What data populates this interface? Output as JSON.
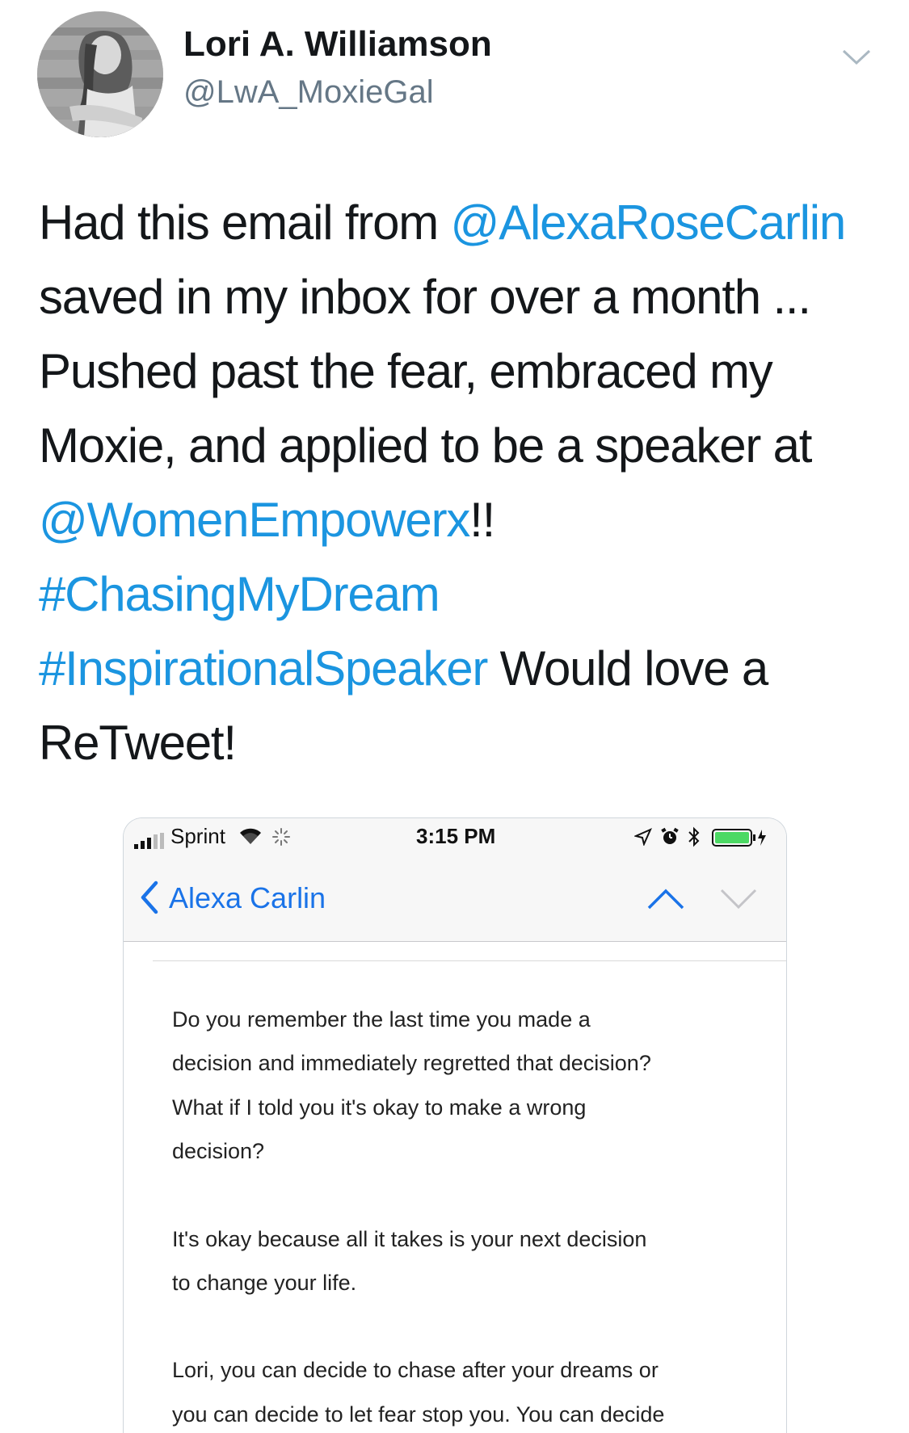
{
  "tweet": {
    "author_name": "Lori A. Williamson",
    "author_handle": "@LwA_MoxieGal",
    "lines": [
      [
        {
          "t": "Had this email from ",
          "link": false
        },
        {
          "t": "@AlexaRoseCarlin",
          "link": true
        }
      ],
      [
        {
          "t": "saved in my inbox for over a month ...",
          "link": false
        }
      ],
      [
        {
          "t": "Pushed past the fear, embraced my",
          "link": false
        }
      ],
      [
        {
          "t": "Moxie, and applied to be a speaker at",
          "link": false
        }
      ],
      [
        {
          "t": "@WomenEmpowerx",
          "link": true
        },
        {
          "t": "!!",
          "link": false
        }
      ],
      [
        {
          "t": "#ChasingMyDream",
          "link": true
        }
      ],
      [
        {
          "t": "#InspirationalSpeaker",
          "link": true
        },
        {
          "t": " Would love a",
          "link": false
        }
      ],
      [
        {
          "t": "ReTweet!",
          "link": false
        }
      ]
    ]
  },
  "screenshot": {
    "status_bar": {
      "carrier": "Sprint",
      "time": "3:15 PM"
    },
    "nav": {
      "back_label": "Alexa Carlin"
    },
    "email_paragraphs": [
      [
        "Do you remember the last time you made a",
        "decision and immediately regretted that decision?",
        "What if I told you it's okay to make a wrong",
        "decision?"
      ],
      [
        "It's okay because all it takes is your next decision",
        "to change your life."
      ],
      [
        "Lori, you can decide to chase after your dreams or",
        "you can decide to let fear stop you. You can decide"
      ]
    ]
  },
  "colors": {
    "link": "#1b95e0",
    "handle": "#657786",
    "ios_blue": "#1a73e8",
    "battery_green": "#4cd964"
  },
  "icons": {
    "caret": "chevron-down-icon",
    "back": "chevron-left-icon",
    "up": "chevron-up-icon",
    "down": "chevron-down-icon",
    "wifi": "wifi-icon",
    "battery": "battery-icon"
  }
}
